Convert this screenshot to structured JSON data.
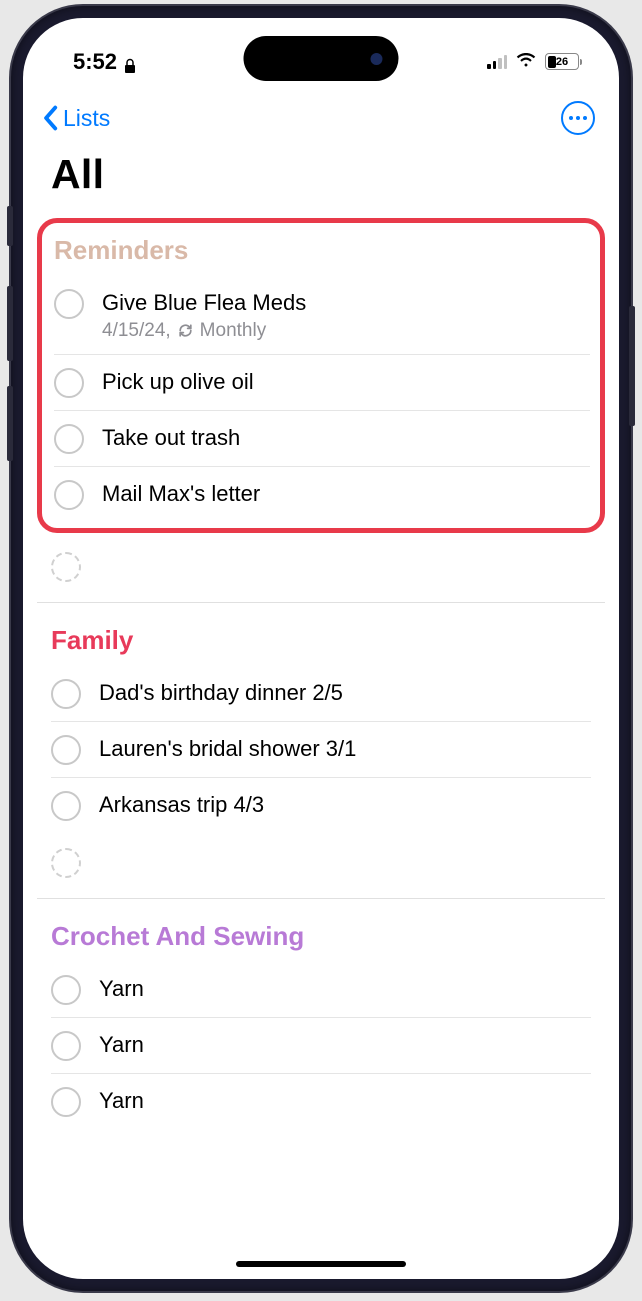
{
  "status": {
    "time": "5:52",
    "battery": "26"
  },
  "nav": {
    "back_label": "Lists"
  },
  "page": {
    "title": "All"
  },
  "sections": {
    "reminders": {
      "header": "Reminders",
      "items": [
        {
          "title": "Give Blue Flea Meds",
          "date": "4/15/24,",
          "repeat": "Monthly"
        },
        {
          "title": "Pick up olive oil"
        },
        {
          "title": "Take out trash"
        },
        {
          "title": "Mail Max's letter"
        }
      ]
    },
    "family": {
      "header": "Family",
      "items": [
        {
          "title": "Dad's birthday dinner 2/5"
        },
        {
          "title": "Lauren's bridal shower 3/1"
        },
        {
          "title": "Arkansas trip 4/3"
        }
      ]
    },
    "crochet": {
      "header": "Crochet And Sewing",
      "items": [
        {
          "title": "Yarn"
        },
        {
          "title": "Yarn"
        },
        {
          "title": "Yarn"
        }
      ]
    }
  }
}
